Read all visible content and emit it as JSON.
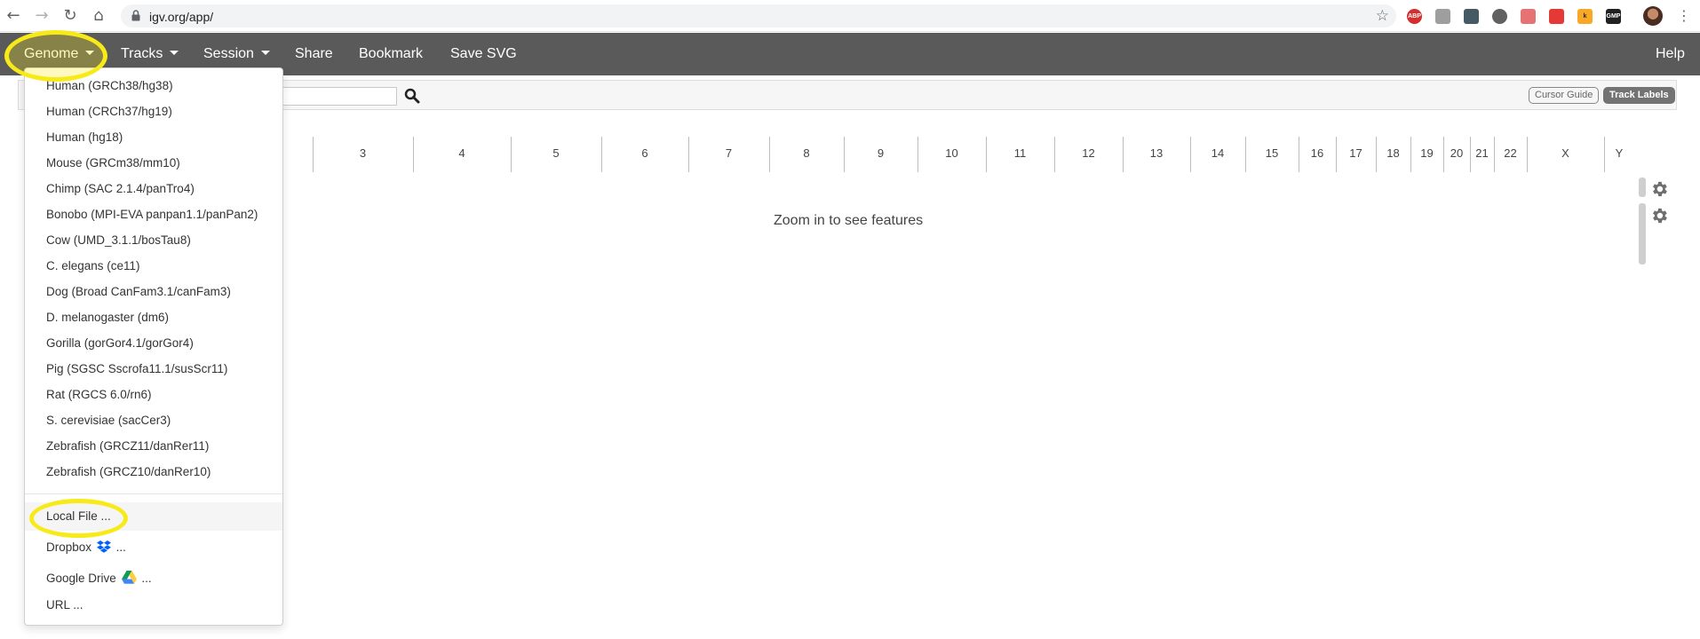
{
  "browser": {
    "url": "igv.org/app/",
    "colors": {
      "accent": "#5a5a5a",
      "highlight": "#f7ea18"
    },
    "extensions": [
      "ABP",
      "",
      "",
      "",
      "",
      "",
      "k",
      "GMP"
    ]
  },
  "navbar": {
    "genome": "Genome",
    "tracks": "Tracks",
    "session": "Session",
    "share": "Share",
    "bookmark": "Bookmark",
    "save_svg": "Save SVG",
    "help": "Help"
  },
  "toolbar": {
    "cursor_guide": "Cursor Guide",
    "track_labels": "Track Labels"
  },
  "genome_menu": {
    "genomes": [
      "Human (GRCh38/hg38)",
      "Human (CRCh37/hg19)",
      "Human (hg18)",
      "Mouse (GRCm38/mm10)",
      "Chimp (SAC 2.1.4/panTro4)",
      "Bonobo (MPI-EVA panpan1.1/panPan2)",
      "Cow (UMD_3.1.1/bosTau8)",
      "C. elegans (ce11)",
      "Dog (Broad CanFam3.1/canFam3)",
      "D. melanogaster (dm6)",
      "Gorilla (gorGor4.1/gorGor4)",
      "Pig (SGSC Sscrofa11.1/susScr11)",
      "Rat (RGCS 6.0/rn6)",
      "S. cerevisiae (sacCer3)",
      "Zebrafish (GRCZ11/danRer11)",
      "Zebrafish (GRCZ10/danRer10)"
    ],
    "local_file": "Local File ...",
    "dropbox": "Dropbox",
    "dropbox_suffix": "...",
    "google_drive": "Google Drive",
    "google_drive_suffix": "...",
    "url": "URL ..."
  },
  "ideogram": {
    "chromosomes": [
      "3",
      "4",
      "5",
      "6",
      "7",
      "8",
      "9",
      "10",
      "11",
      "12",
      "13",
      "14",
      "15",
      "16",
      "17",
      "18",
      "19",
      "20",
      "21",
      "22",
      "X",
      "Y"
    ]
  },
  "main": {
    "zoom_message": "Zoom in to see features"
  }
}
